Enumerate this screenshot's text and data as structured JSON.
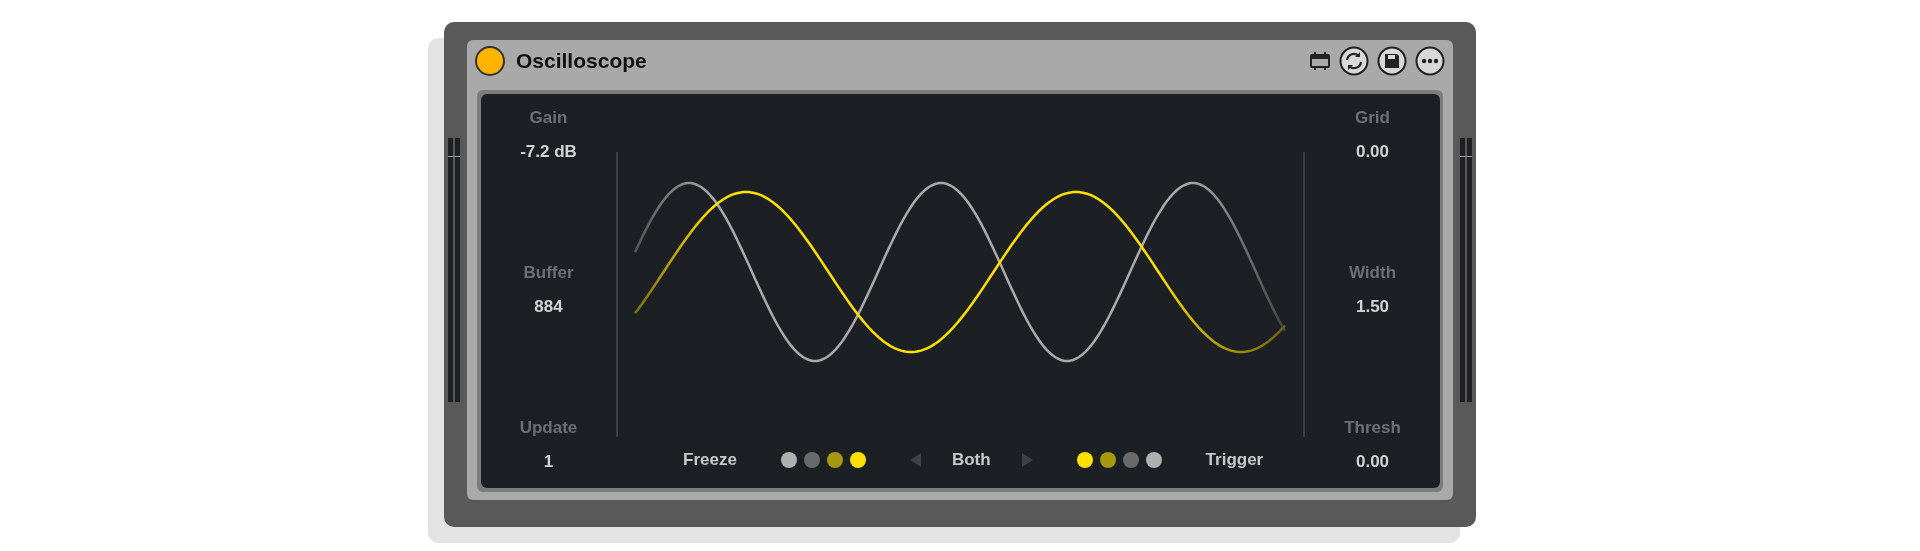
{
  "device": {
    "title": "Oscilloscope",
    "power": {
      "on": true
    }
  },
  "left_params": [
    {
      "label": "Gain",
      "value": "-7.2 dB"
    },
    {
      "label": "Buffer",
      "value": "884"
    },
    {
      "label": "Update",
      "value": "1"
    }
  ],
  "right_params": [
    {
      "label": "Grid",
      "value": "0.00"
    },
    {
      "label": "Width",
      "value": "1.50"
    },
    {
      "label": "Thresh",
      "value": "0.00"
    }
  ],
  "freeze": {
    "label": "Freeze",
    "dots": [
      {
        "color": "#b0b0b0"
      },
      {
        "color": "#6a6a6a"
      },
      {
        "color": "#a69912"
      },
      {
        "color": "#ffe000"
      }
    ]
  },
  "mode": {
    "label": "Both"
  },
  "trigger": {
    "label": "Trigger",
    "dots": [
      {
        "color": "#ffe000"
      },
      {
        "color": "#a69912"
      },
      {
        "color": "#6a6a6a"
      },
      {
        "color": "#b0b0b0"
      }
    ]
  }
}
